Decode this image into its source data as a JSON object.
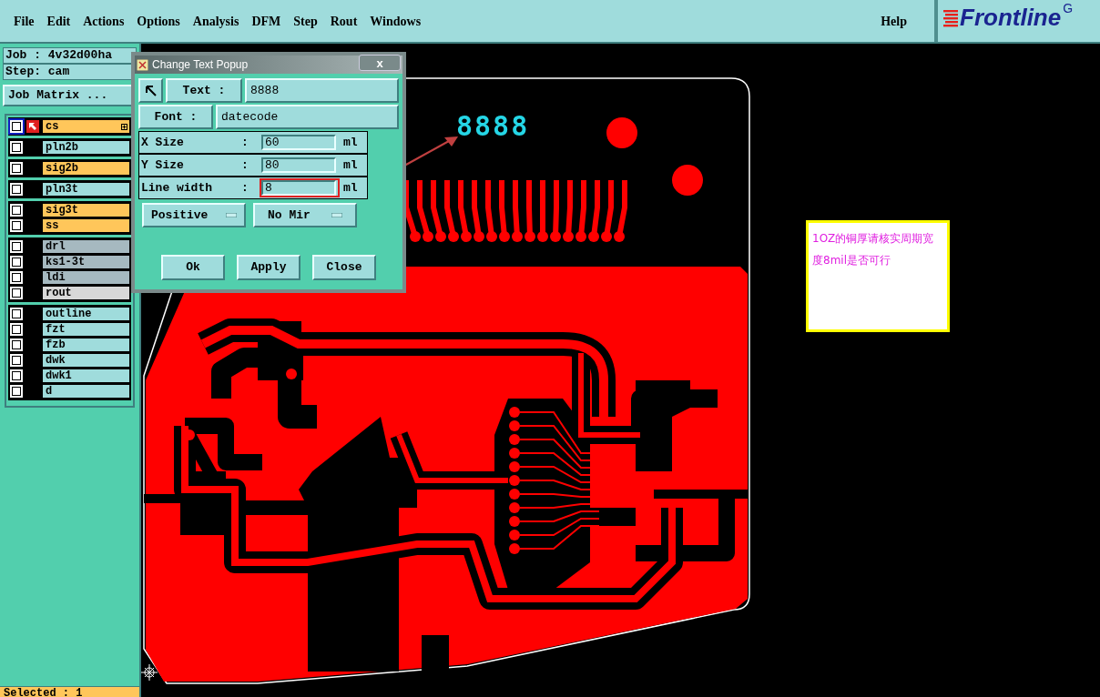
{
  "menu": [
    {
      "label": "File"
    },
    {
      "label": "Edit"
    },
    {
      "label": "Actions"
    },
    {
      "label": "Options"
    },
    {
      "label": "Analysis"
    },
    {
      "label": "DFM"
    },
    {
      "label": "Step"
    },
    {
      "label": "Rout"
    },
    {
      "label": "Windows"
    }
  ],
  "help": "Help",
  "logo": {
    "text": "Frontline",
    "corner": "G"
  },
  "job_panel": {
    "job": "Job : 4v32d00ha",
    "step": "Step: cam",
    "matrix_button": "Job Matrix ..."
  },
  "layer_groups": [
    {
      "layers": [
        {
          "name": "cs",
          "color": "#ffc65a",
          "work": true,
          "checked": false
        }
      ]
    },
    {
      "layers": [
        {
          "name": "pln2b",
          "color": "#9fdcdc",
          "work": false,
          "checked": false
        }
      ]
    },
    {
      "layers": [
        {
          "name": "sig2b",
          "color": "#ffc65a",
          "work": false,
          "checked": false
        }
      ]
    },
    {
      "layers": [
        {
          "name": "pln3t",
          "color": "#9fdcdc",
          "work": false,
          "checked": false
        }
      ]
    },
    {
      "layers": [
        {
          "name": "sig3t",
          "color": "#ffc65a",
          "work": false,
          "checked": false
        },
        {
          "name": "ss",
          "color": "#ffc65a",
          "work": false,
          "checked": false
        }
      ]
    },
    {
      "layers": [
        {
          "name": "drl",
          "color": "#a6b9c0",
          "work": false,
          "checked": false
        },
        {
          "name": "ks1-3t",
          "color": "#a6b9c0",
          "work": false,
          "checked": false
        },
        {
          "name": "ldi",
          "color": "#a6b9c0",
          "work": false,
          "checked": false
        },
        {
          "name": "rout",
          "color": "#d8d8d8",
          "work": false,
          "checked": false
        }
      ]
    },
    {
      "layers": [
        {
          "name": "outline",
          "color": "#9fdcdc",
          "work": false,
          "checked": false
        },
        {
          "name": "fzt",
          "color": "#9fdcdc",
          "work": false,
          "checked": false
        },
        {
          "name": "fzb",
          "color": "#9fdcdc",
          "work": false,
          "checked": false
        },
        {
          "name": "dwk",
          "color": "#9fdcdc",
          "work": false,
          "checked": false
        },
        {
          "name": "dwk1",
          "color": "#9fdcdc",
          "work": false,
          "checked": false
        },
        {
          "name": "d",
          "color": "#9fdcdc",
          "work": false,
          "checked": false
        }
      ]
    }
  ],
  "status_bar": {
    "text": "Selected : 1"
  },
  "dialog": {
    "title": "Change Text Popup",
    "close": "x",
    "text_label": "Text :",
    "text_value": "8888",
    "font_label": "Font :",
    "font_value": "datecode",
    "fields": [
      {
        "label": "X Size",
        "colon": ":",
        "value": "60",
        "unit": "ml",
        "highlighted": false
      },
      {
        "label": "Y Size",
        "colon": ":",
        "value": "80",
        "unit": "ml",
        "highlighted": false
      },
      {
        "label": "Line width",
        "colon": ":",
        "value": "8",
        "unit": "ml",
        "highlighted": true
      }
    ],
    "polarity": "Positive",
    "mirror": "No Mir",
    "buttons": [
      "Ok",
      "Apply",
      "Close"
    ]
  },
  "canvas": {
    "datecode": "8888",
    "note": "1OZ的铜厚请核实周期宽度8mil是否可行"
  }
}
